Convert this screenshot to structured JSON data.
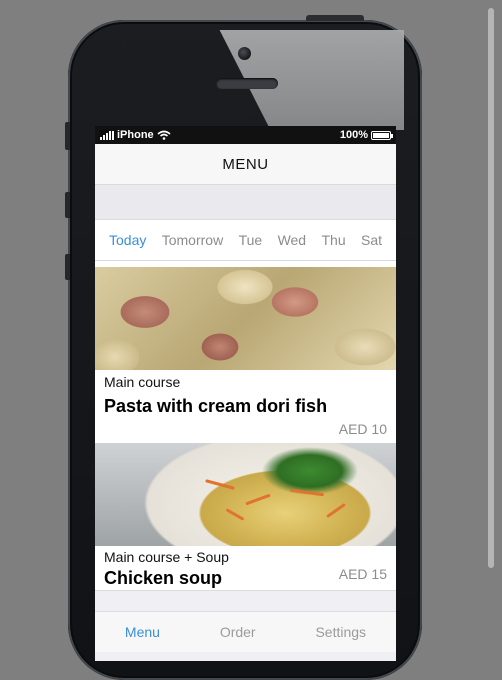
{
  "status_bar": {
    "carrier": "iPhone",
    "battery": "100%"
  },
  "nav": {
    "title": "MENU"
  },
  "day_tabs": [
    "Today",
    "Tomorrow",
    "Tue",
    "Wed",
    "Thu",
    "Sat"
  ],
  "active_day_tab": "Today",
  "menu_items": [
    {
      "category": "Main course",
      "name": "Pasta with cream dori fish",
      "price": "AED 10",
      "photo": "pasta-photo"
    },
    {
      "category": "Main course + Soup",
      "name": "Chicken soup",
      "price": "AED 15",
      "photo": "soup-photo"
    }
  ],
  "bottom_tabs": [
    "Menu",
    "Order",
    "Settings"
  ],
  "active_bottom_tab": "Menu",
  "colors": {
    "accent": "#3a8fd9",
    "muted_text": "#8c8c8c",
    "background": "#7f7f7f"
  }
}
